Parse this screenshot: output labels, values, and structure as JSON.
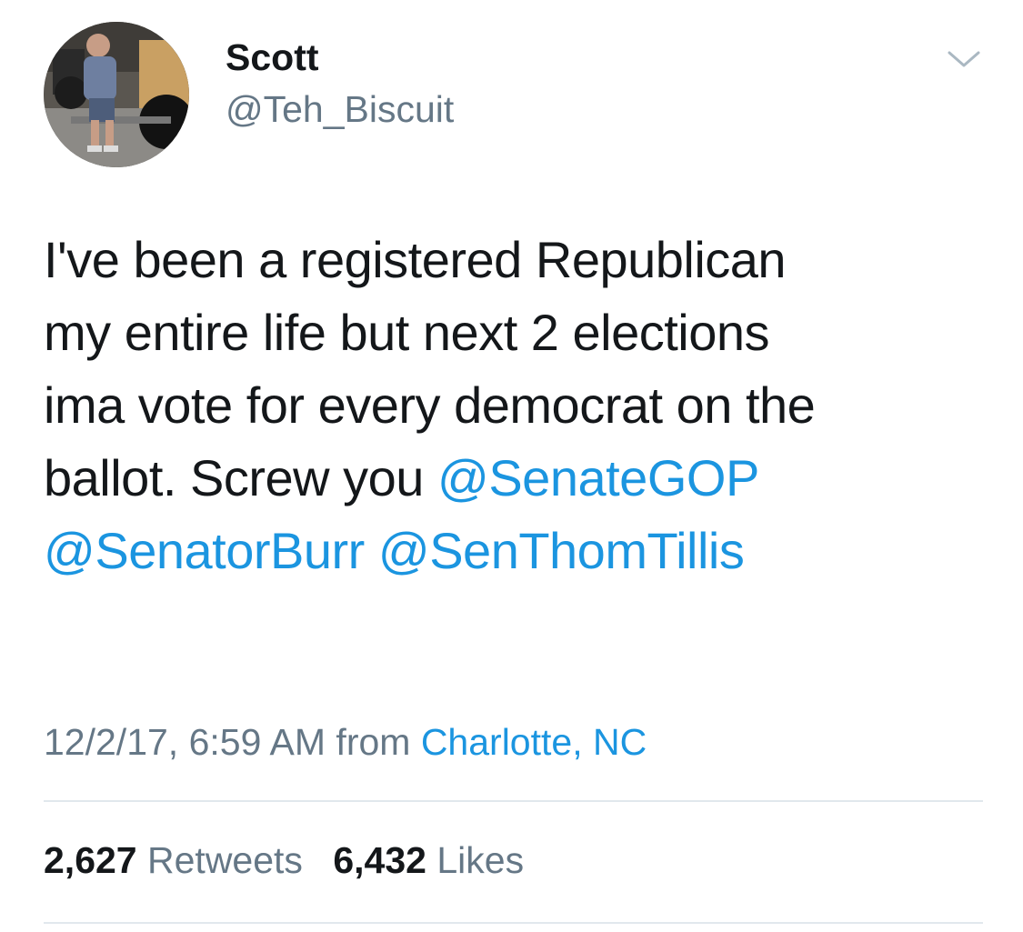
{
  "user": {
    "display_name": "Scott",
    "handle": "@Teh_Biscuit",
    "avatar_icon": "profile-photo"
  },
  "tweet": {
    "text_parts": {
      "line1": "I've been a registered Republican",
      "line2": "my entire life but next 2 elections",
      "line3": "ima vote for every democrat on the",
      "line4_text": "ballot. Screw you ",
      "mention1": "@SenateGOP",
      "mention2": "@SenatorBurr",
      "mention3": "@SenThomTillis"
    },
    "timestamp": "12/2/17, 6:59 AM",
    "from_label": "from",
    "location": "Charlotte, NC"
  },
  "stats": {
    "retweets_count": "2,627",
    "retweets_label": "Retweets",
    "likes_count": "6,432",
    "likes_label": "Likes"
  },
  "colors": {
    "link": "#1b95e0",
    "secondary_text": "#657786",
    "primary_text": "#14171a",
    "divider": "#e1e8ed"
  }
}
